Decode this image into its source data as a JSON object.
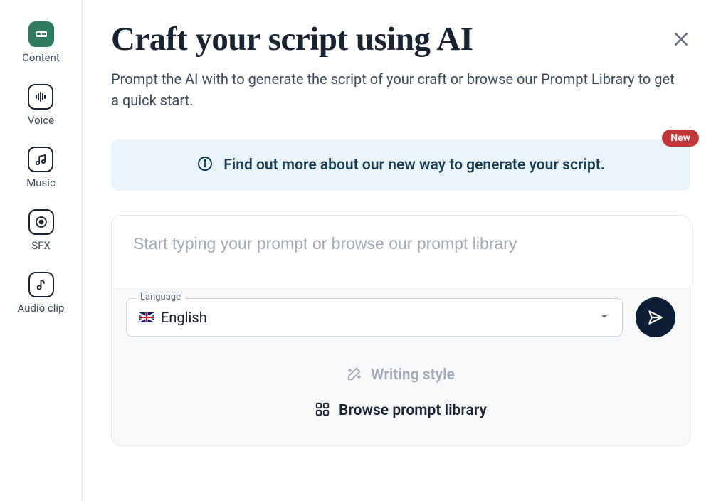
{
  "sidebar": {
    "items": [
      {
        "label": "Content"
      },
      {
        "label": "Voice"
      },
      {
        "label": "Music"
      },
      {
        "label": "SFX"
      },
      {
        "label": "Audio clip"
      }
    ]
  },
  "header": {
    "title": "Craft your script using AI",
    "subtitle": "Prompt the AI with to generate the script of your craft or browse our Prompt Library to get a quick start."
  },
  "banner": {
    "text": "Find out more about our new way to generate your script.",
    "badge": "New"
  },
  "prompt": {
    "placeholder": "Start typing your prompt or browse our prompt library",
    "language_label": "Language",
    "language_value": "English"
  },
  "options": {
    "writing_style": "Writing style",
    "browse_library": "Browse prompt library"
  }
}
